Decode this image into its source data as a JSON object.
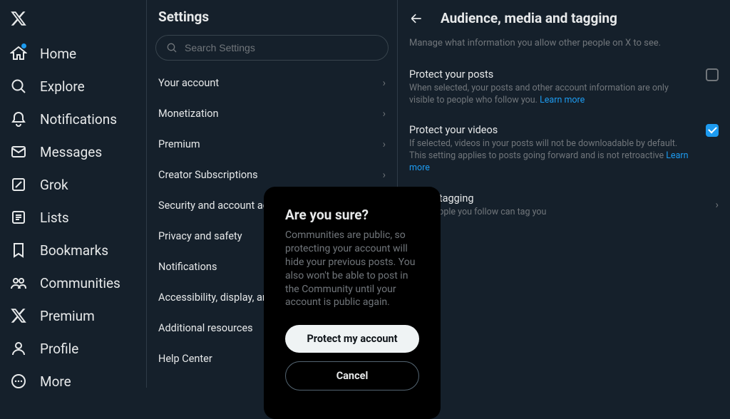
{
  "nav": {
    "items": [
      {
        "label": "Home",
        "icon": "home-icon",
        "dot": true
      },
      {
        "label": "Explore",
        "icon": "search-icon"
      },
      {
        "label": "Notifications",
        "icon": "bell-icon"
      },
      {
        "label": "Messages",
        "icon": "mail-icon"
      },
      {
        "label": "Grok",
        "icon": "grok-icon"
      },
      {
        "label": "Lists",
        "icon": "list-icon"
      },
      {
        "label": "Bookmarks",
        "icon": "bookmark-icon"
      },
      {
        "label": "Communities",
        "icon": "communities-icon"
      },
      {
        "label": "Premium",
        "icon": "x-icon"
      },
      {
        "label": "Profile",
        "icon": "profile-icon"
      },
      {
        "label": "More",
        "icon": "more-icon"
      }
    ]
  },
  "settings": {
    "title": "Settings",
    "search_placeholder": "Search Settings",
    "items": [
      "Your account",
      "Monetization",
      "Premium",
      "Creator Subscriptions",
      "Security and account access",
      "Privacy and safety",
      "Notifications",
      "Accessibility, display, and languages",
      "Additional resources",
      "Help Center"
    ]
  },
  "detail": {
    "title": "Audience, media and tagging",
    "subtitle": "Manage what information you allow other people on X to see.",
    "protect_posts": {
      "title": "Protect your posts",
      "desc": "When selected, your posts and other account information are only visible to people who follow you. ",
      "link": "Learn more",
      "checked": false
    },
    "protect_videos": {
      "title": "Protect your videos",
      "desc": "If selected, videos in your posts will not be downloadable by default. This setting applies to posts going forward and is not retroactive ",
      "link": "Learn more",
      "checked": true
    },
    "photo_tagging": {
      "title": "Photo tagging",
      "desc": "Only people you follow can tag you"
    }
  },
  "modal": {
    "title": "Are you sure?",
    "body": "Communities are public, so protecting your account will hide your previous posts. You also won't be able to post in the Community until your account is public again.",
    "confirm": "Protect my account",
    "cancel": "Cancel"
  }
}
